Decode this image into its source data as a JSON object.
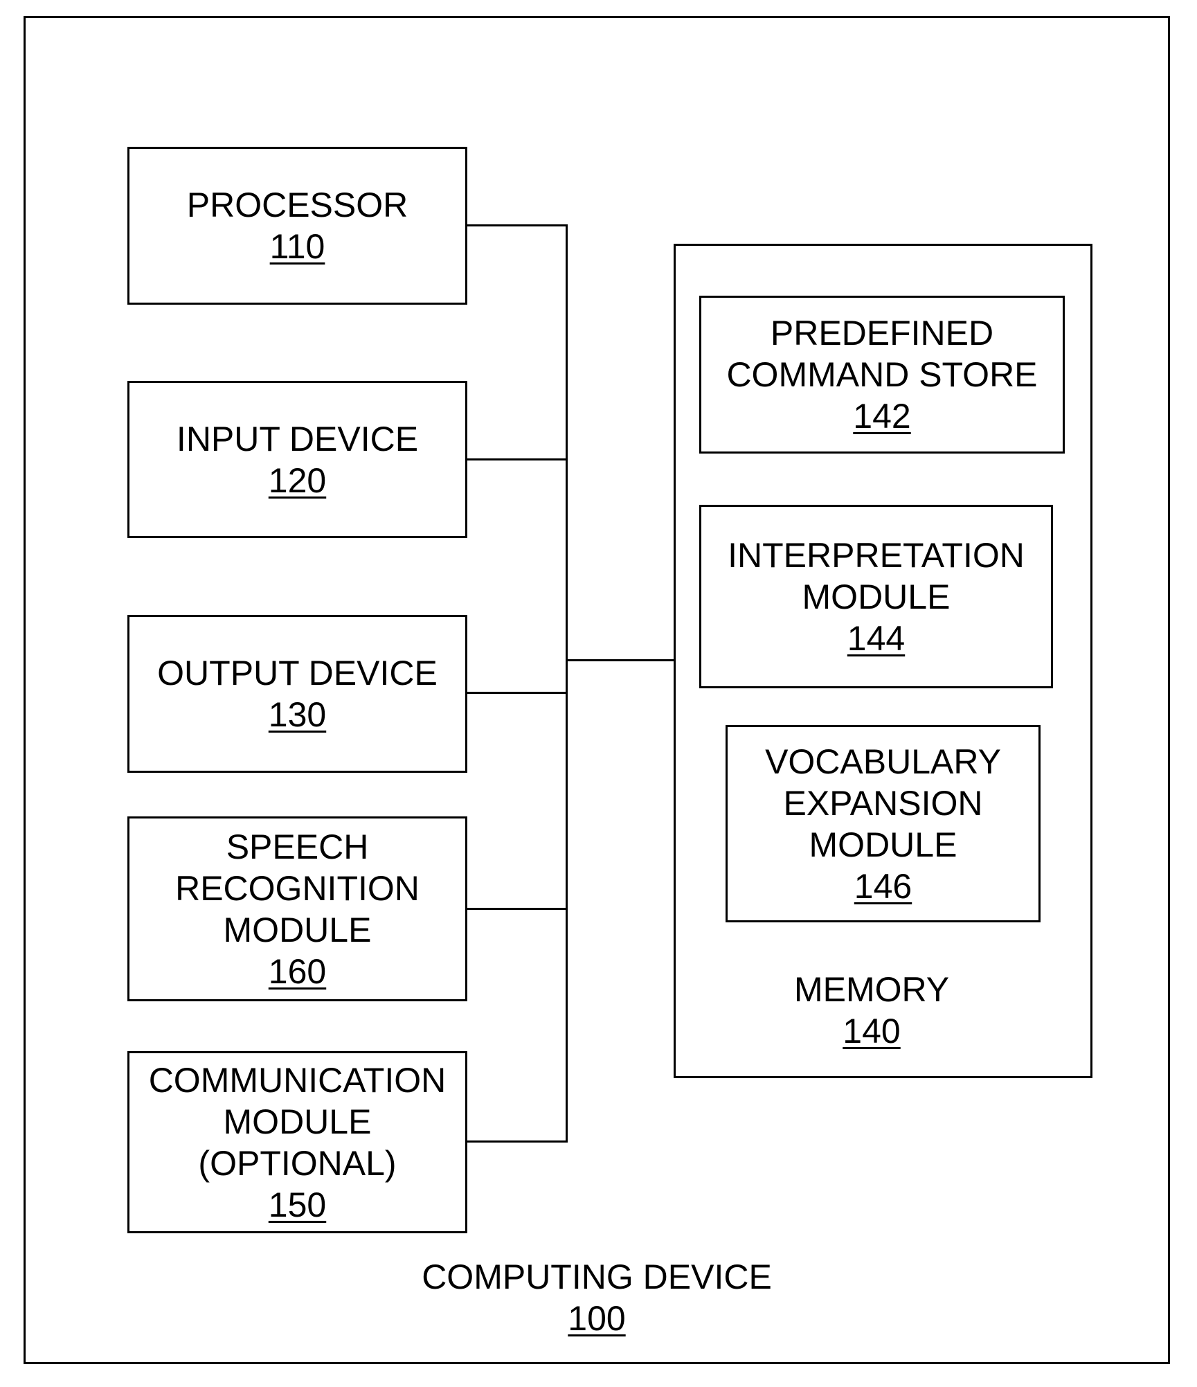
{
  "diagram": {
    "container": {
      "title": "COMPUTING DEVICE",
      "ref": "100"
    },
    "left_components": [
      {
        "id": "processor",
        "lines": [
          "PROCESSOR"
        ],
        "ref": "110"
      },
      {
        "id": "input-device",
        "lines": [
          "INPUT DEVICE"
        ],
        "ref": "120"
      },
      {
        "id": "output-device",
        "lines": [
          "OUTPUT DEVICE"
        ],
        "ref": "130"
      },
      {
        "id": "speech-recognition-module",
        "lines": [
          "SPEECH",
          "RECOGNITION",
          "MODULE"
        ],
        "ref": "160"
      },
      {
        "id": "communication-module",
        "lines": [
          "COMMUNICATION",
          "MODULE",
          "(OPTIONAL)"
        ],
        "ref": "150"
      }
    ],
    "memory": {
      "title": "MEMORY",
      "ref": "140",
      "components": [
        {
          "id": "predefined-command-store",
          "lines": [
            "PREDEFINED",
            "COMMAND STORE"
          ],
          "ref": "142"
        },
        {
          "id": "interpretation-module",
          "lines": [
            "INTERPRETATION",
            "MODULE"
          ],
          "ref": "144"
        },
        {
          "id": "vocabulary-expansion-module",
          "lines": [
            "VOCABULARY",
            "EXPANSION",
            "MODULE"
          ],
          "ref": "146"
        }
      ]
    },
    "connections": [
      {
        "from": "processor",
        "to": "bus"
      },
      {
        "from": "input-device",
        "to": "bus"
      },
      {
        "from": "output-device",
        "to": "bus"
      },
      {
        "from": "speech-recognition-module",
        "to": "bus"
      },
      {
        "from": "communication-module",
        "to": "bus"
      },
      {
        "from": "bus",
        "to": "memory"
      }
    ]
  }
}
